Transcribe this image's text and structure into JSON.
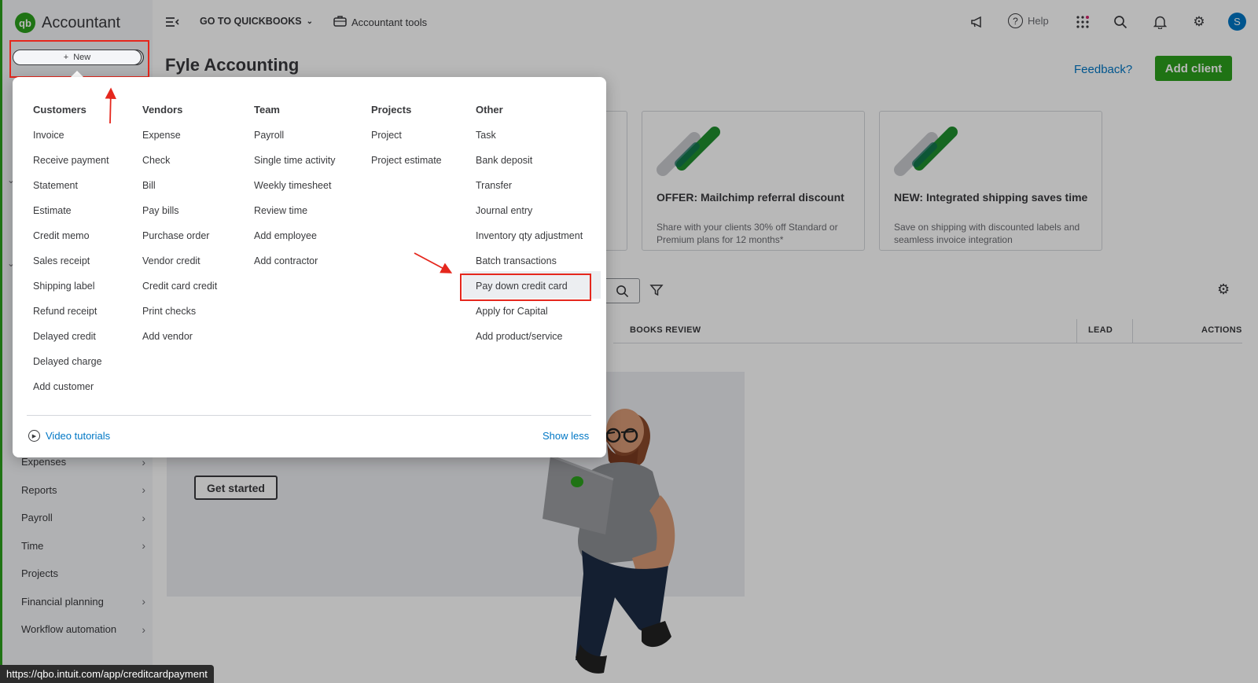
{
  "app": {
    "logo_mark": "qb",
    "logo_text": "Accountant",
    "new_button": "New",
    "new_plus": "+"
  },
  "topbar": {
    "go_to_qb": "GO TO QUICKBOOKS",
    "accountant_tools": "Accountant tools",
    "help": "Help",
    "avatar_letter": "S",
    "icons": [
      "menu-collapse-icon",
      "briefcase-icon",
      "megaphone-icon",
      "help-icon",
      "apps-icon",
      "search-icon",
      "bell-icon",
      "gear-icon"
    ]
  },
  "page": {
    "title": "Fyle Accounting",
    "feedback": "Feedback?",
    "add_client": "Add client"
  },
  "cards": [
    {
      "title": "OFFER: Mailchimp referral discount",
      "desc": "Share with your clients 30% off Standard or Premium plans for 12 months*"
    },
    {
      "title": "NEW: Integrated shipping saves time",
      "desc": "Save on shipping with discounted labels and seamless invoice integration"
    }
  ],
  "table": {
    "col_books_review": "BOOKS REVIEW",
    "col_lead": "LEAD",
    "col_actions": "ACTIONS"
  },
  "empty_state": {
    "get_started": "Get started"
  },
  "sidebar": {
    "items": [
      {
        "label": "Expenses",
        "chevron": true
      },
      {
        "label": "Reports",
        "chevron": true
      },
      {
        "label": "Payroll",
        "chevron": true
      },
      {
        "label": "Time",
        "chevron": true
      },
      {
        "label": "Projects",
        "chevron": false
      },
      {
        "label": "Financial planning",
        "chevron": true
      },
      {
        "label": "Workflow automation",
        "chevron": true
      }
    ]
  },
  "menu": {
    "columns": [
      {
        "heading": "Customers",
        "items": [
          "Invoice",
          "Receive payment",
          "Statement",
          "Estimate",
          "Credit memo",
          "Sales receipt",
          "Shipping label",
          "Refund receipt",
          "Delayed credit",
          "Delayed charge",
          "Add customer"
        ]
      },
      {
        "heading": "Vendors",
        "items": [
          "Expense",
          "Check",
          "Bill",
          "Pay bills",
          "Purchase order",
          "Vendor credit",
          "Credit card credit",
          "Print checks",
          "Add vendor"
        ]
      },
      {
        "heading": "Team",
        "items": [
          "Payroll",
          "Single time activity",
          "Weekly timesheet",
          "Review time",
          "Add employee",
          "Add contractor"
        ]
      },
      {
        "heading": "Projects",
        "items": [
          "Project",
          "Project estimate"
        ]
      },
      {
        "heading": "Other",
        "items": [
          "Task",
          "Bank deposit",
          "Transfer",
          "Journal entry",
          "Inventory qty adjustment",
          "Batch transactions",
          "Pay down credit card",
          "Apply for Capital",
          "Add product/service"
        ]
      }
    ],
    "video_tutorials": "Video tutorials",
    "show_less": "Show less",
    "highlighted_item": "Pay down credit card"
  },
  "status_bar": {
    "url": "https://qbo.intuit.com/app/creditcardpayment"
  },
  "colors": {
    "brand_green": "#2ca01c",
    "link_blue": "#0077c5",
    "annotation_red": "#e5271d"
  }
}
